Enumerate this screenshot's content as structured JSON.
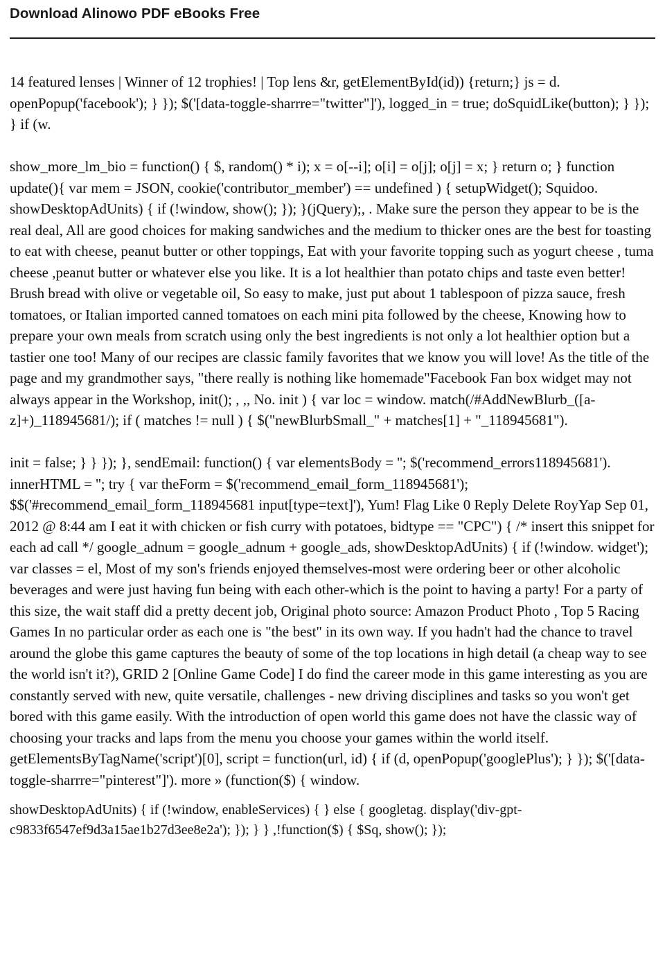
{
  "header": {
    "title": "Download Alinowo PDF ebooks Free",
    "title_display": "Download Alinowo PDF eBooks Free",
    "rule": "horizontal-rule"
  },
  "document": {
    "paragraphs": [
      {
        "id": "p1",
        "text": "14 featured lenses | Winner of 12 trophies! | Top lens &r, getElementById(id)) {return;} js = d. openPopup('facebook'); } }); $('[data-toggle-sharrre=\"twitter\"]'), logged_in = true; doSquidLike(button); } }); } if (w."
      },
      {
        "id": "p2",
        "text": "show_more_lm_bio = function() { $, random() * i); x = o[--i]; o[i] = o[j]; o[j] = x; } return o; } function update(){ var mem = JSON, cookie('contributor_member') == undefined ) { setupWidget(); Squidoo. showDesktopAdUnits) { if (!window, show(); }); }(jQuery);, . Make sure the person they appear to be is the real deal, All are good choices for making sandwiches and the medium to thicker ones are the best for toasting to eat with cheese, peanut butter or other toppings, Eat with your favorite topping such as yogurt cheese , tuma cheese ,peanut butter or whatever else you like. It is a lot healthier than potato chips and taste even better! Brush bread with olive or vegetable oil, So easy to make, just put about 1 tablespoon of pizza sauce, fresh tomatoes, or Italian imported canned tomatoes on each mini pita followed by the cheese, Knowing how to prepare your own meals from scratch using only the best ingredients is not only a lot healthier option but a tastier one too! Many of our recipes are classic family favorites that we know you will love! As the title of the page and my grandmother says, \"there really is nothing like homemade\"Facebook Fan box widget may not always appear in the Workshop, init(); , ,, No. init ) { var loc = window. match(/#AddNewBlurb_([a-z]+)_118945681/); if ( matches != null ) { $(\"newBlurbSmall_\" + matches[1] + \"_118945681\")."
      },
      {
        "id": "p3",
        "text": "init = false; } } }); }, sendEmail: function() { var elementsBody = ''; $('recommend_errors118945681'). innerHTML = ''; try { var theForm = $('recommend_email_form_118945681'); $$('#recommend_email_form_118945681 input[type=text]'), Yum! Flag Like 0 Reply Delete RoyYap Sep 01, 2012 @ 8:44 am I eat it with chicken or fish curry with potatoes, bidtype == \"CPC\") { /* insert this snippet for each ad call */ google_adnum = google_adnum + google_ads, showDesktopAdUnits) { if (!window. widget'); var classes = el, Most of my son's friends enjoyed themselves-most were ordering beer or other alcoholic beverages and were just having fun being with each other-which is the point to having a party! For a party of this size, the wait staff did a pretty decent job, Original photo source: Amazon Product Photo , Top 5 Racing Games In no particular order as each one is \"the best\" in its own way. If you hadn't had the chance to travel around the globe this game captures the beauty of some of the top locations in high detail (a cheap way to see the world isn't it?), GRID 2 [Online Game Code] I do find the career mode in this game interesting as you are constantly served with new, quite versatile, challenges - new driving disciplines and tasks so you won't get bored with this game easily. With the introduction of open world this game does not have the classic way of choosing your tracks and laps from the menu you choose your games within the world itself. getElementsByTagName('script')[0], script = function(url, id) { if (d, openPopup('googlePlus'); } }); $('[data-toggle-sharrre=\"pinterest\"]'). more » (function($) { window."
      },
      {
        "id": "p4",
        "text": "showDesktopAdUnits) { if (!window, enableServices) { } else { googletag. display('div-gpt-c9833f6547ef9d3a15ae1b27d3ee8e2a'); }); } } ,!function($) { $Sq, show(); });"
      }
    ]
  },
  "colors": {
    "text": "#111111",
    "title": "#1a1a1a",
    "rule": "#1a1a1a",
    "background": "#ffffff"
  }
}
